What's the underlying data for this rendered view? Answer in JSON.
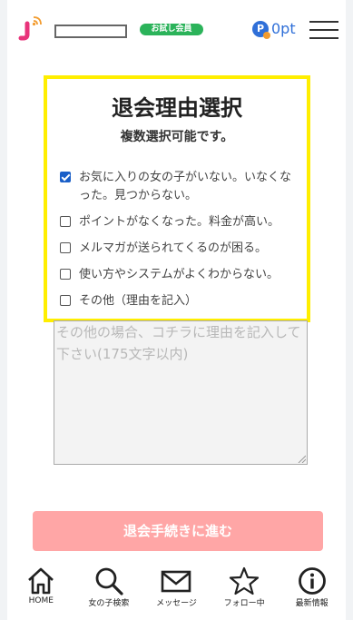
{
  "header": {
    "member_badge": "お試し会員",
    "points": "0pt",
    "point_icon_letter": "P"
  },
  "colors": {
    "logo_pink": "#e8337a",
    "logo_signal": "#f29b2e",
    "badge_green": "#2bb35a",
    "point_blue": "#2f6fd8",
    "panel_border": "#ffee00",
    "checkbox_checked": "#1a5fc8",
    "proceed_button": "#ffa6a6"
  },
  "reasons": {
    "title": "退会理由選択",
    "subtitle": "複数選択可能です。",
    "options": [
      {
        "label": "お気に入りの女の子がいない。いなくなった。見つからない。",
        "checked": true
      },
      {
        "label": "ポイントがなくなった。料金が高い。",
        "checked": false
      },
      {
        "label": "メルマガが送られてくるのが困る。",
        "checked": false
      },
      {
        "label": "使い方やシステムがよくわからない。",
        "checked": false
      },
      {
        "label": "その他（理由を記入）",
        "checked": false
      }
    ]
  },
  "other_reason": {
    "placeholder": "その他の場合、コチラに理由を記入して下さい(175文字以内)",
    "value": ""
  },
  "proceed_label": "退会手続きに進む",
  "nav": [
    {
      "label": "HOME",
      "icon": "home-icon"
    },
    {
      "label": "女の子検索",
      "icon": "search-icon"
    },
    {
      "label": "メッセージ",
      "icon": "mail-icon"
    },
    {
      "label": "フォロー中",
      "icon": "star-icon"
    },
    {
      "label": "最新情報",
      "icon": "info-icon"
    }
  ]
}
